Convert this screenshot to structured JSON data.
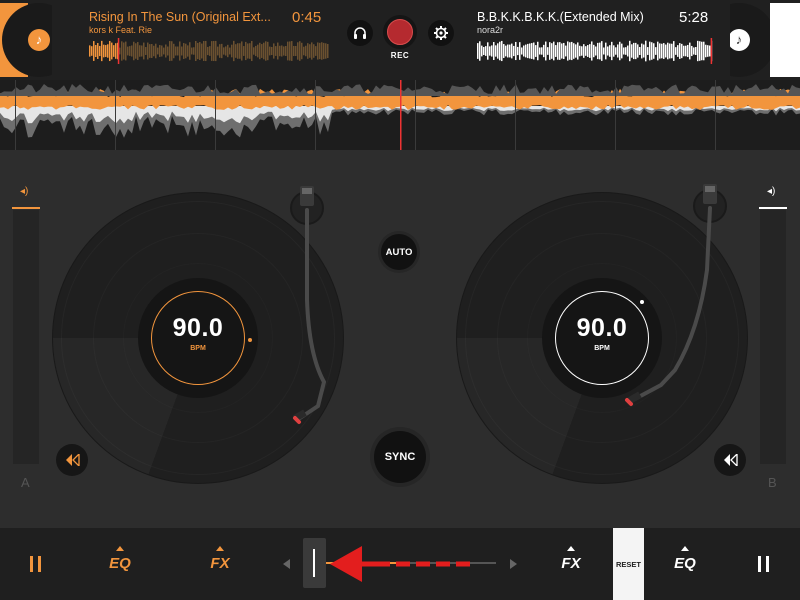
{
  "colors": {
    "accent": "#f2953d",
    "deck_b": "#ffffff",
    "rec": "#b52a2f",
    "annotation_arrow": "#e31e1e"
  },
  "deck_a": {
    "title": "Rising In The Sun (Original Ext...",
    "artist": "kors k Feat. Rie",
    "time": "0:45",
    "bpm": "90.0",
    "bpm_label": "BPM",
    "letter": "A",
    "play_position": 0.12
  },
  "deck_b": {
    "title": "B.B.K.K.B.K.K.(Extended Mix)",
    "artist": "nora2r",
    "time": "5:28",
    "bpm": "90.0",
    "bpm_label": "BPM",
    "letter": "B",
    "play_position": 0.99
  },
  "center": {
    "headphones_icon": "headphones-icon",
    "rec_label": "REC",
    "settings_icon": "gear-icon",
    "auto_label": "AUTO",
    "sync_label": "SYNC"
  },
  "bottom": {
    "eq_label": "EQ",
    "fx_label": "FX",
    "reset_label": "RESET",
    "crossfader_position": 0.0,
    "crossfader_fill": 0.44
  }
}
